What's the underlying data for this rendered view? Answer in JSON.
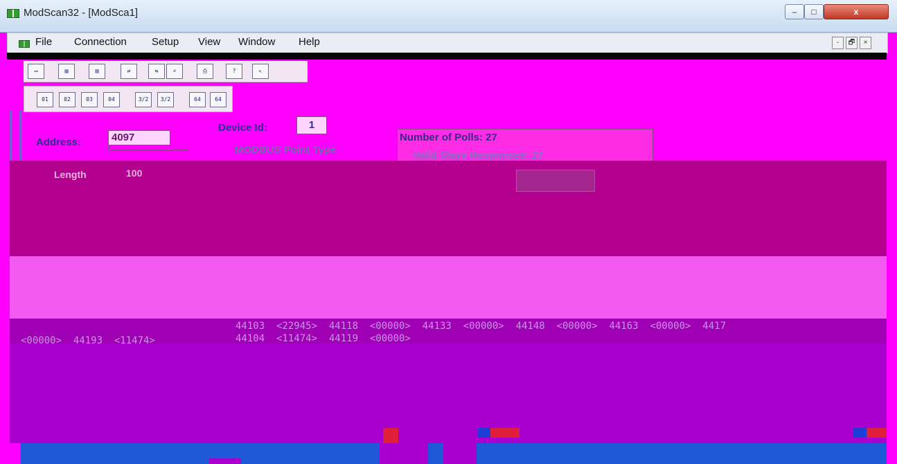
{
  "window": {
    "title": "ModScan32 - [ModSca1]",
    "controls": {
      "minimize": "–",
      "maximize": "□",
      "close": "x"
    }
  },
  "menu": {
    "items": [
      "File",
      "Connection",
      "Setup",
      "View",
      "Window",
      "Help"
    ],
    "mdi_controls": {
      "minimize": "-",
      "restore": "🗗",
      "close": "×"
    }
  },
  "toolbar2": {
    "buttons": [
      "01",
      "02",
      "03",
      "04",
      "3/2",
      "3/2",
      "64",
      "64"
    ]
  },
  "form": {
    "address_label": "Address:",
    "address_value": "4097",
    "device_label": "Device Id:",
    "device_value": "1",
    "point_type_label": "MODBUS Point Type",
    "length_label": "Length",
    "length_value": "100"
  },
  "stats": {
    "polls": "Number of Polls: 27",
    "responses": "Valid Slave Responses: 27"
  },
  "registers": {
    "row1": "44103  <22945>  44118  <00000>  44133  <00000>  44148  <00000>  44163  <00000>  4417",
    "row2": "<00000>  44193  <11474>",
    "row3": "44104  <11474>  44119  <00000>"
  },
  "colors": {
    "titlebar": "#d6e4f5",
    "menubar": "#e9ecf2",
    "background": "#ff00ff",
    "statusbar": "#1e5ad8"
  }
}
